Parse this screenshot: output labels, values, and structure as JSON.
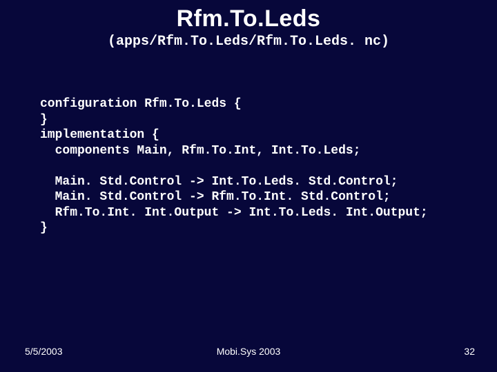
{
  "title": "Rfm.To.Leds",
  "subtitle": "(apps/Rfm.To.Leds/Rfm.To.Leds. nc)",
  "code": {
    "l1": "configuration Rfm.To.Leds {",
    "l2": "}",
    "l3": "implementation {",
    "l4": "  components Main, Rfm.To.Int, Int.To.Leds;",
    "blank1": "",
    "l5": "  Main. Std.Control -> Int.To.Leds. Std.Control;",
    "l6": "  Main. Std.Control -> Rfm.To.Int. Std.Control;",
    "l7": "  Rfm.To.Int. Int.Output -> Int.To.Leds. Int.Output;",
    "l8": "}"
  },
  "footer": {
    "date": "5/5/2003",
    "venue": "Mobi.Sys 2003",
    "page": "32"
  }
}
